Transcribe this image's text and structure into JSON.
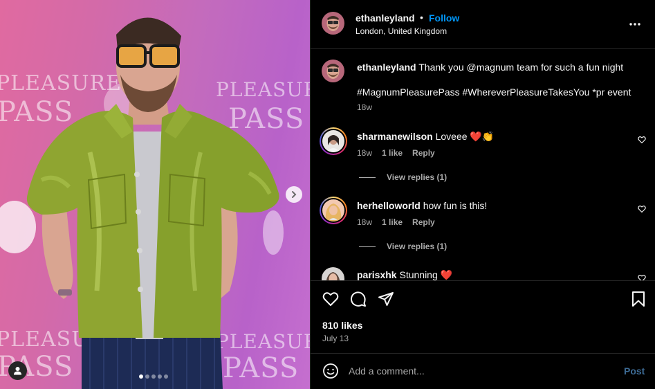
{
  "media": {
    "backdrop_texts": [
      "PLEASURE",
      "PASS",
      "PLEASURE",
      "PASS",
      "PLEASURE",
      "PASS",
      "PLEASURE",
      "PASS"
    ],
    "carousel_dots": 5,
    "active_dot": 0,
    "icons": {
      "next": "chevron-right-icon",
      "tag": "user-tag-icon"
    },
    "colors": {
      "backdrop_pink": "#e06aa0",
      "backdrop_purple": "#b862c9",
      "shirt": "#8fa531"
    }
  },
  "header": {
    "username": "ethanleyland",
    "separator": "•",
    "follow_label": "Follow",
    "location": "London, United Kingdom",
    "more_icon": "more-horizontal-icon"
  },
  "caption": {
    "username": "ethanleyland",
    "text": "Thank you @magnum team for such a fun night",
    "hashtags": "#MagnumPleasurePass #WhereverPleasureTakesYou *pr event",
    "time": "18w"
  },
  "comments": [
    {
      "username": "sharmanewilson",
      "text": "Loveee ❤️👏",
      "time": "18w",
      "likes": "1 like",
      "reply_label": "Reply",
      "view_replies": "View replies (1)"
    },
    {
      "username": "herhelloworld",
      "text": "how fun is this!",
      "time": "18w",
      "likes": "1 like",
      "reply_label": "Reply",
      "view_replies": "View replies (1)"
    },
    {
      "username": "parisxhk",
      "text": "Stunning ❤️"
    }
  ],
  "actions": {
    "likes": "810 likes",
    "date": "July 13",
    "icons": [
      "heart-icon",
      "comment-icon",
      "share-icon",
      "bookmark-icon"
    ]
  },
  "add_comment": {
    "placeholder": "Add a comment...",
    "post_label": "Post",
    "emoji_icon": "emoji-icon"
  },
  "colors": {
    "link_blue": "#0095f6",
    "post_disabled": "#3d6b95",
    "muted_text": "#a8a8a8",
    "divider": "#262626"
  }
}
